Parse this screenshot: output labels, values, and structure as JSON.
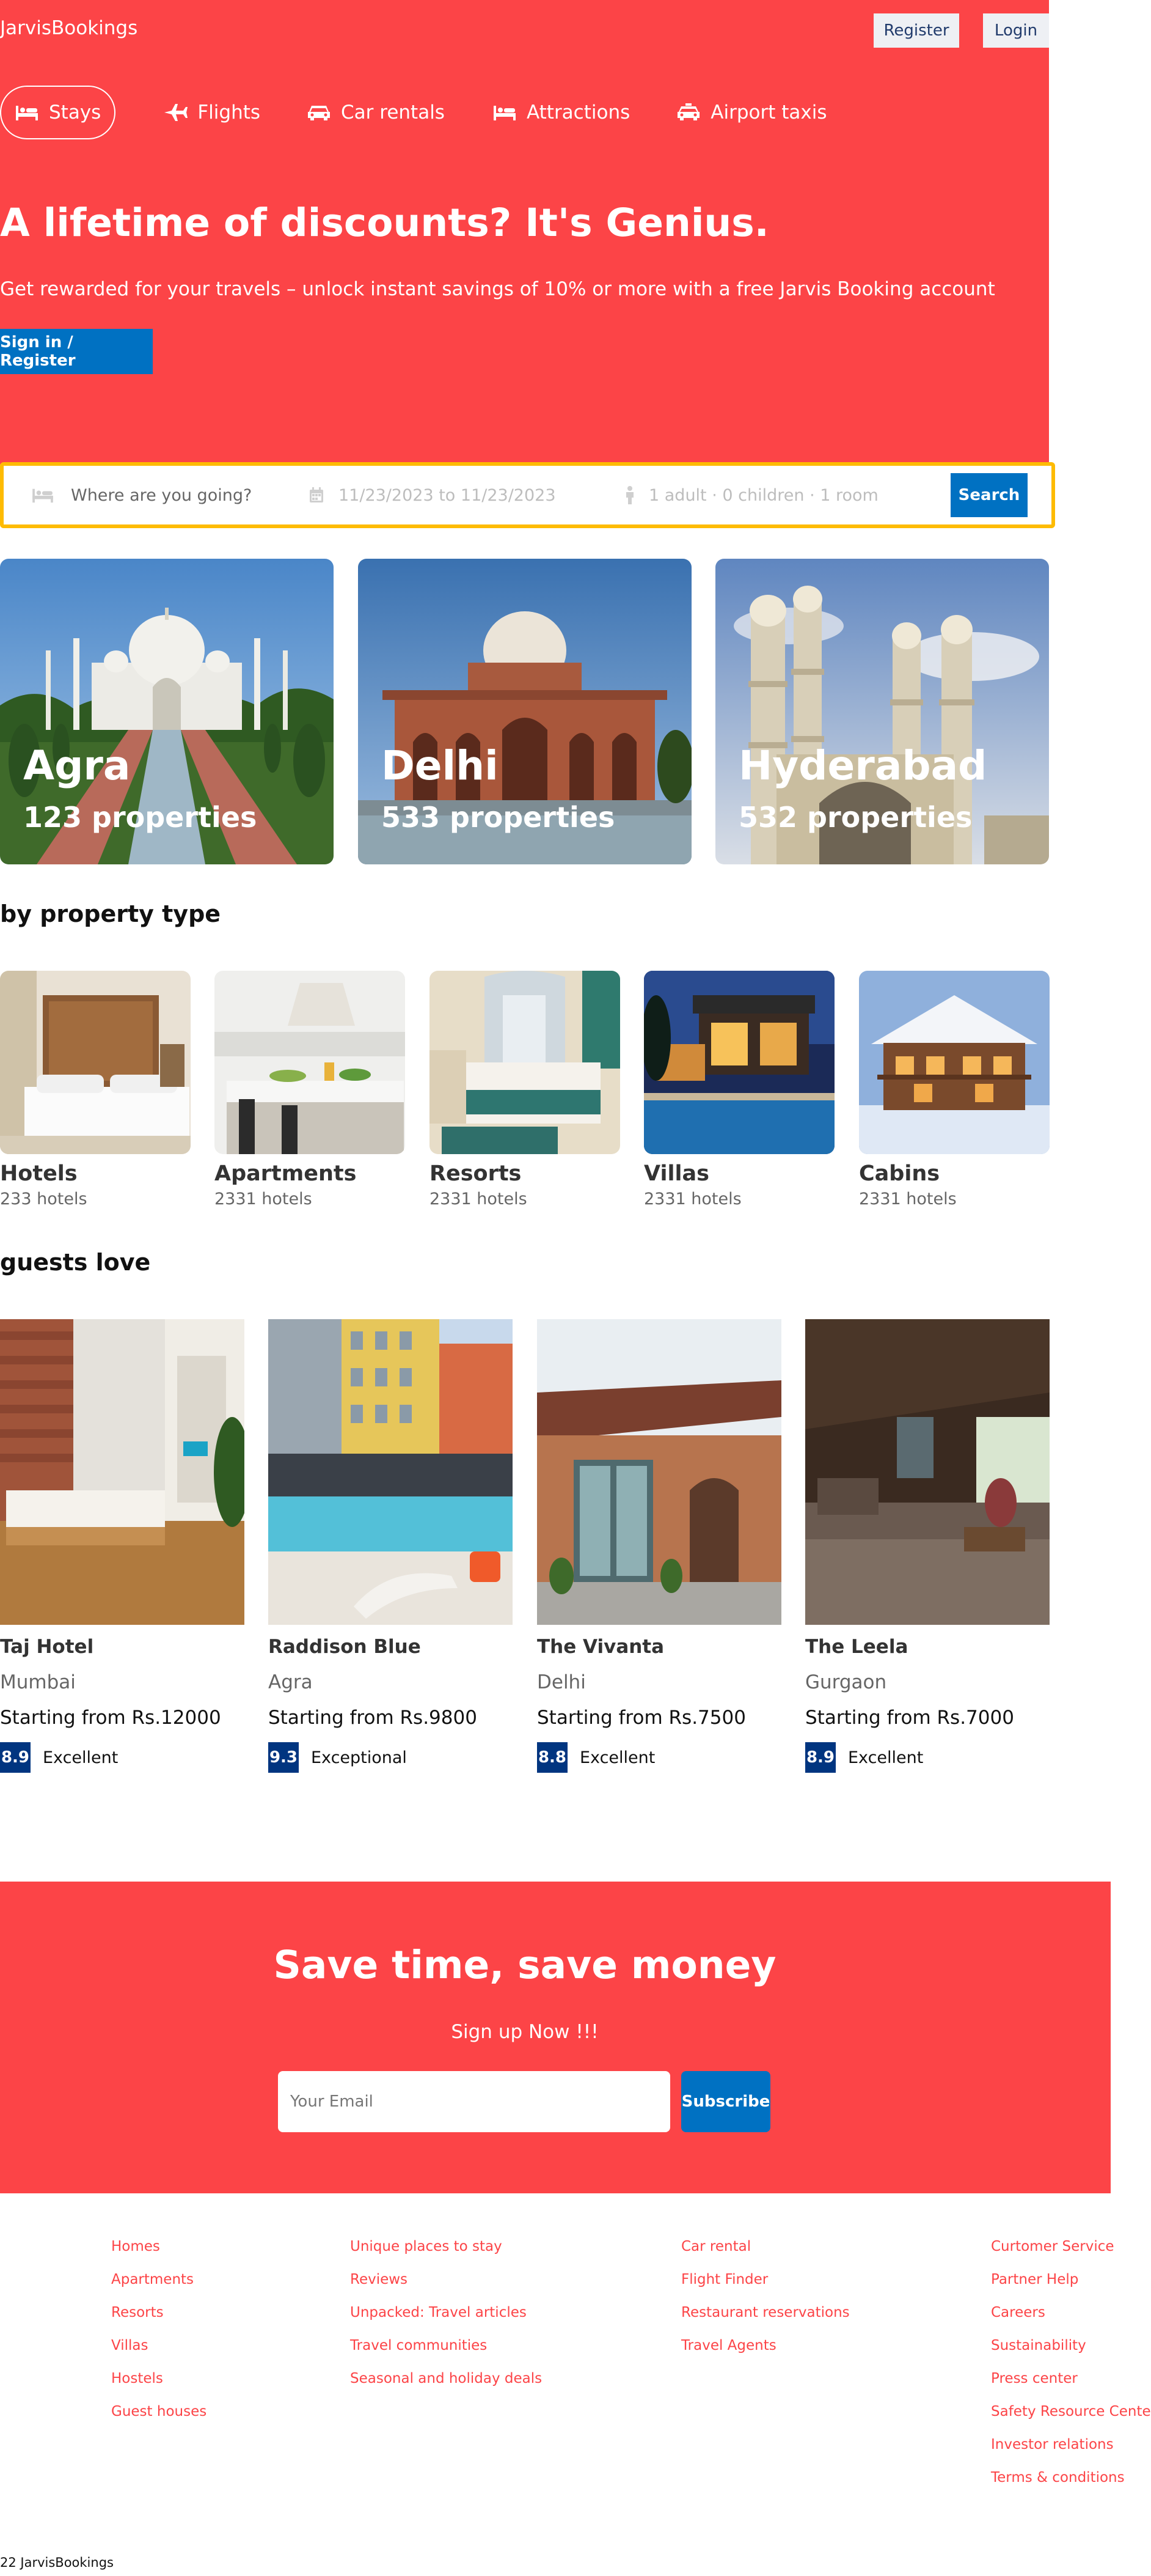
{
  "header": {
    "logo": "JarvisBookings",
    "register": "Register",
    "login": "Login"
  },
  "nav": {
    "items": [
      {
        "label": "Stays",
        "icon": "bed-icon",
        "active": true
      },
      {
        "label": "Flights",
        "icon": "plane-icon",
        "active": false
      },
      {
        "label": "Car rentals",
        "icon": "car-icon",
        "active": false
      },
      {
        "label": "Attractions",
        "icon": "bed-icon",
        "active": false
      },
      {
        "label": "Airport taxis",
        "icon": "taxi-icon",
        "active": false
      }
    ]
  },
  "hero": {
    "title": "A lifetime of discounts? It's Genius.",
    "subtitle": "Get rewarded for your travels – unlock instant savings of 10% or more with a free Jarvis Booking account",
    "signin": "Sign in / Register"
  },
  "search": {
    "destination_placeholder": "Where are you going?",
    "dates": "11/23/2023 to 11/23/2023",
    "guests": "1 adult · 0 children · 1 room",
    "button": "Search"
  },
  "cities": [
    {
      "name": "Agra",
      "properties": "123 properties"
    },
    {
      "name": "Delhi",
      "properties": "533 properties"
    },
    {
      "name": "Hyderabad",
      "properties": "532 properties"
    }
  ],
  "property_section_title": "by property type",
  "property_types": [
    {
      "name": "Hotels",
      "count": "233 hotels"
    },
    {
      "name": "Apartments",
      "count": "2331 hotels"
    },
    {
      "name": "Resorts",
      "count": "2331 hotels"
    },
    {
      "name": "Villas",
      "count": "2331 hotels"
    },
    {
      "name": "Cabins",
      "count": "2331 hotels"
    }
  ],
  "hotels_section_title": "guests love",
  "hotels": [
    {
      "name": "Taj Hotel",
      "city": "Mumbai",
      "price": "Starting from Rs.12000",
      "score": "8.9",
      "rating": "Excellent"
    },
    {
      "name": "Raddison Blue",
      "city": "Agra",
      "price": "Starting from Rs.9800",
      "score": "9.3",
      "rating": "Exceptional"
    },
    {
      "name": "The Vivanta",
      "city": "Delhi",
      "price": "Starting from Rs.7500",
      "score": "8.8",
      "rating": "Excellent"
    },
    {
      "name": "The Leela",
      "city": "Gurgaon",
      "price": "Starting from Rs.7000",
      "score": "8.9",
      "rating": "Excellent"
    }
  ],
  "newsletter": {
    "title": "Save time, save money",
    "subtitle": "Sign up Now !!!",
    "placeholder": "Your Email",
    "button": "Subscribe"
  },
  "footer": {
    "col1": [
      "Homes",
      "Apartments",
      "Resorts",
      "Villas",
      "Hostels",
      "Guest houses"
    ],
    "col2": [
      "Unique places to stay",
      "Reviews",
      "Unpacked: Travel articles",
      "Travel communities",
      "Seasonal and holiday deals"
    ],
    "col3": [
      "Car rental",
      "Flight Finder",
      "Restaurant reservations",
      "Travel Agents"
    ],
    "col4": [
      "Curtomer Service",
      "Partner Help",
      "Careers",
      "Sustainability",
      "Press center",
      "Safety Resource Center",
      "Investor relations",
      "Terms & conditions"
    ],
    "copyright": "22 JarvisBookings"
  },
  "colors": {
    "brand_red": "#fc4447",
    "button_blue": "#0071c2",
    "score_navy": "#003580",
    "search_border": "#febb02"
  }
}
